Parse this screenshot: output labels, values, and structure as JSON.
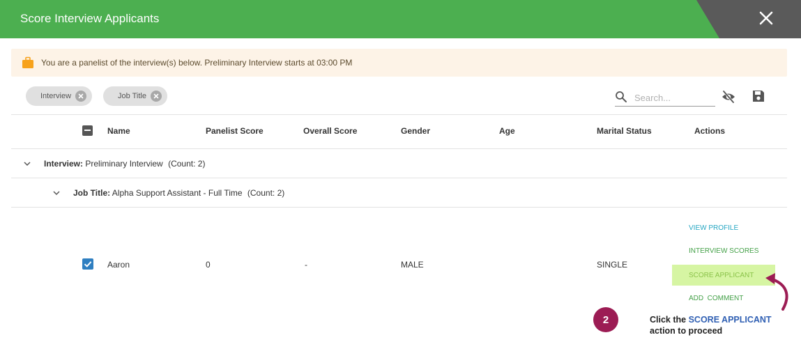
{
  "dialog": {
    "title": "Score Interview Applicants",
    "close_icon": "close-icon",
    "header_color": "#4caf50"
  },
  "notice": {
    "icon": "briefcase-icon",
    "text": "You are a panelist of the interview(s) below. Preliminary Interview starts at 03:00 PM"
  },
  "filters": {
    "chips": [
      {
        "label": "Interview"
      },
      {
        "label": "Job Title"
      }
    ],
    "search": {
      "placeholder": "Search...",
      "value": ""
    },
    "icons": [
      "search-icon",
      "eye-off-icon",
      "save-icon"
    ]
  },
  "table": {
    "columns": [
      "Name",
      "Panelist Score",
      "Overall Score",
      "Gender",
      "Age",
      "Marital Status",
      "Actions"
    ],
    "group1": {
      "label": "Interview:",
      "value": "Preliminary Interview",
      "count": "(Count: 2)"
    },
    "group2": {
      "label": "Job Title:",
      "value": "Alpha Support Assistant - Full Time",
      "count": "(Count: 2)"
    },
    "rows": [
      {
        "checked": true,
        "name": "Aaron",
        "panelist_score": "0",
        "overall_score": "-",
        "gender": "MALE",
        "age": "",
        "marital_status": "SINGLE",
        "actions": [
          "VIEW PROFILE",
          "INTERVIEW SCORES",
          "SCORE APPLICANT",
          "ADD  COMMENT"
        ]
      }
    ]
  },
  "callout": {
    "step": "2",
    "prefix": "Click the ",
    "accent": "SCORE APPLICANT",
    "suffix": "action to proceed",
    "badge_color": "#9c1c54",
    "accent_color": "#2f5fb3"
  }
}
